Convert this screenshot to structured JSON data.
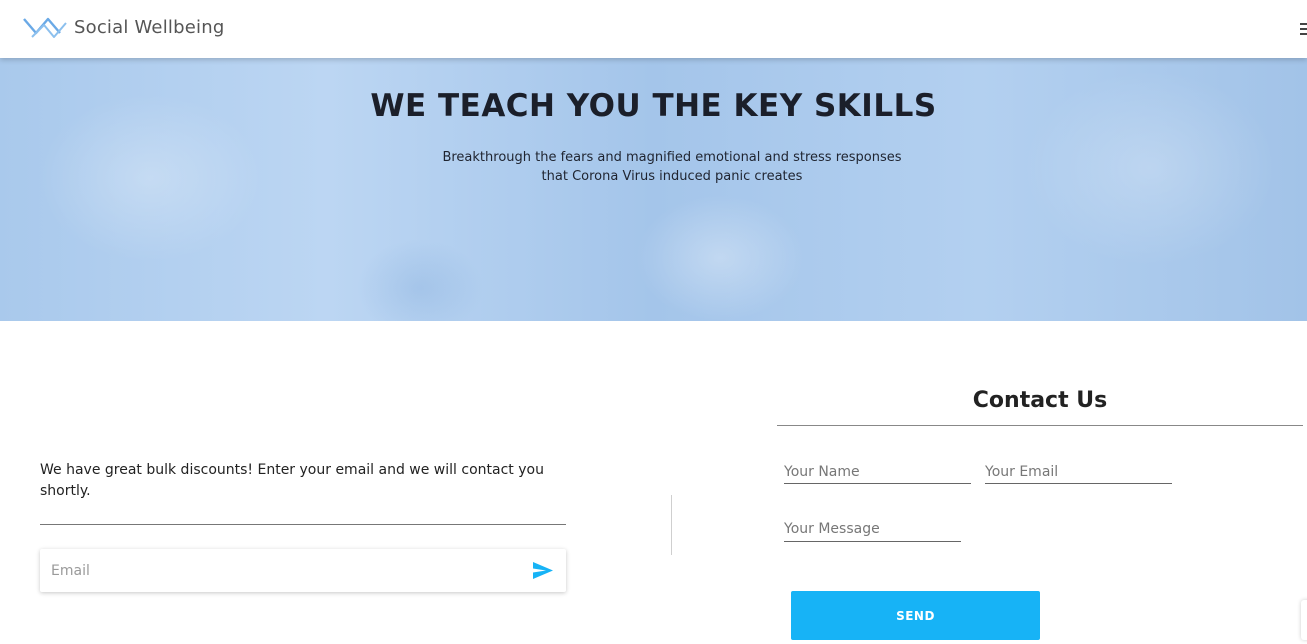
{
  "header": {
    "brand": "Social Wellbeing",
    "logo_icon": "sw-logo-icon",
    "menu_icon": "hamburger-menu-icon"
  },
  "hero": {
    "title": "WE TEACH YOU THE KEY SKILLS",
    "subtitle": "Breakthrough the fears and magnified emotional and stress responses that Corona Virus induced panic creates"
  },
  "discount": {
    "text": "We have great bulk discounts! Enter your email and we will contact you shortly.",
    "email_placeholder": "Email",
    "submit_icon": "send-arrow-icon"
  },
  "contact": {
    "title": "Contact Us",
    "name_placeholder": "Your Name",
    "email_placeholder": "Your Email",
    "message_placeholder": "Your Message",
    "send_label": "SEND"
  },
  "colors": {
    "accent": "#17b3f6",
    "hero_bg": "#a9c9ec",
    "logo": "#4a90d9"
  }
}
